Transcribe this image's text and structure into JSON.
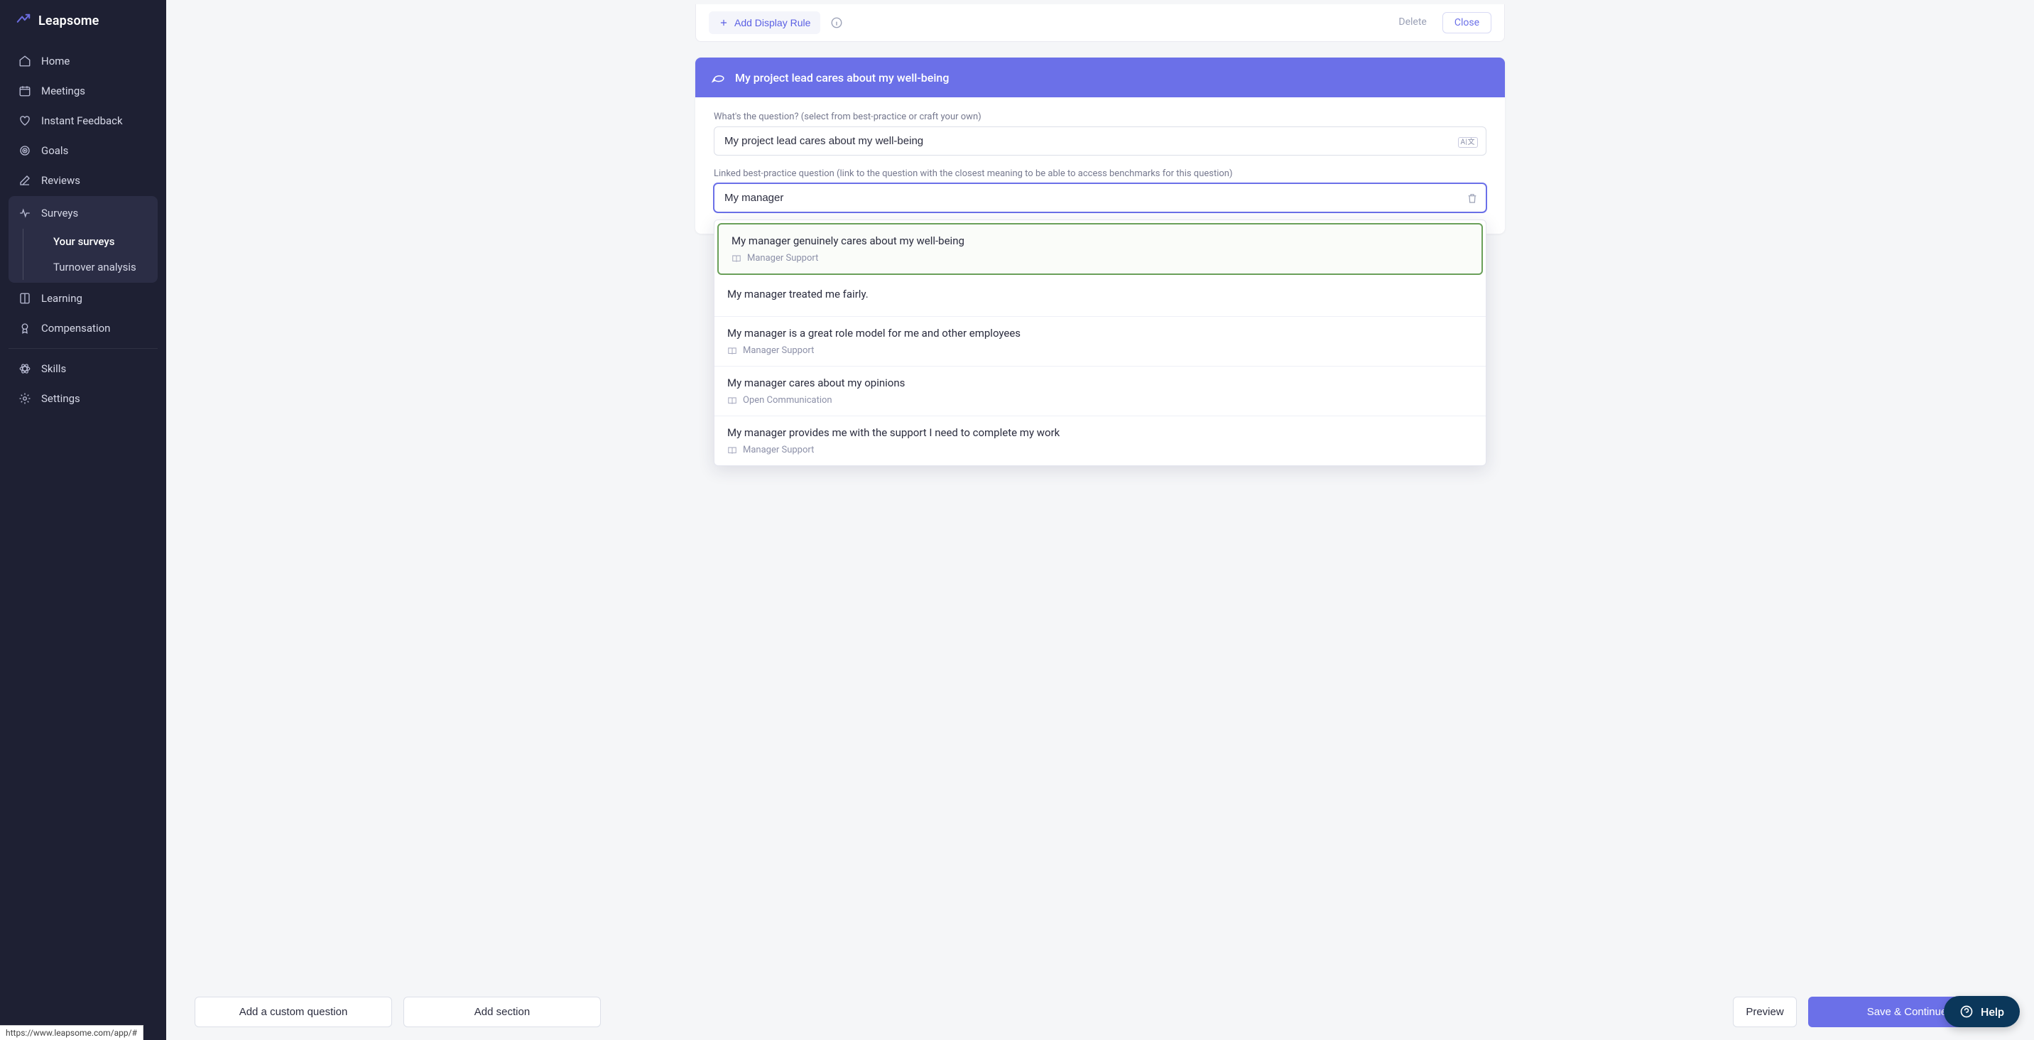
{
  "brand": {
    "name": "Leapsome"
  },
  "sidebar": {
    "items": [
      {
        "label": "Home"
      },
      {
        "label": "Meetings"
      },
      {
        "label": "Instant Feedback"
      },
      {
        "label": "Goals"
      },
      {
        "label": "Reviews"
      },
      {
        "label": "Surveys"
      },
      {
        "label": "Learning"
      },
      {
        "label": "Compensation"
      },
      {
        "label": "Skills"
      },
      {
        "label": "Settings"
      }
    ],
    "surveys_sub": [
      {
        "label": "Your surveys",
        "active": true
      },
      {
        "label": "Turnover analysis",
        "active": false
      }
    ]
  },
  "display_rule": {
    "add_label": "Add Display Rule",
    "delete_label": "Delete",
    "close_label": "Close"
  },
  "question": {
    "header_text": "My project lead cares about my well-being",
    "text_label": "What's the question? (select from best-practice or craft your own)",
    "text_value": "My project lead cares about my well-being",
    "lang_badge": "A|文",
    "linked_label": "Linked best-practice question (link to the question with the closest meaning to be able to access benchmarks for this question)",
    "linked_value": "My manager"
  },
  "suggestions": [
    {
      "title": "My manager genuinely cares about my well-being",
      "category": "Manager Support",
      "selected": true
    },
    {
      "title": "My manager treated me fairly.",
      "category": null,
      "selected": false
    },
    {
      "title": "My manager is a great role model for me and other employees",
      "category": "Manager Support",
      "selected": false
    },
    {
      "title": "My manager cares about my opinions",
      "category": "Open Communication",
      "selected": false
    },
    {
      "title": "My manager provides me with the support I need to complete my work",
      "category": "Manager Support",
      "selected": false
    }
  ],
  "bottom": {
    "add_question": "Add a custom question",
    "add_section": "Add section",
    "preview": "Preview",
    "save": "Save & Continue"
  },
  "help": {
    "label": "Help"
  },
  "status_url": "https://www.leapsome.com/app/#"
}
